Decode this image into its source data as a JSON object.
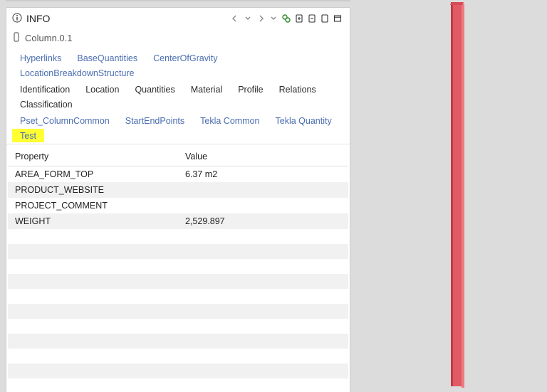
{
  "panel": {
    "title": "INFO",
    "breadcrumb": "Column.0.1"
  },
  "tabs": {
    "row1": [
      "Hyperlinks",
      "BaseQuantities",
      "CenterOfGravity",
      "LocationBreakdownStructure"
    ],
    "row2": [
      "Identification",
      "Location",
      "Quantities",
      "Material",
      "Profile",
      "Relations",
      "Classification"
    ],
    "row3": [
      "Pset_ColumnCommon",
      "StartEndPoints",
      "Tekla Common",
      "Tekla Quantity",
      "Test"
    ]
  },
  "table": {
    "headers": {
      "property": "Property",
      "value": "Value"
    },
    "rows": [
      {
        "name": "AREA_FORM_TOP",
        "value": "6.37 m2"
      },
      {
        "name": "PRODUCT_WEBSITE",
        "value": ""
      },
      {
        "name": "PROJECT_COMMENT",
        "value": ""
      },
      {
        "name": "WEIGHT",
        "value": "2,529.897"
      }
    ]
  },
  "active_tab": "Test"
}
